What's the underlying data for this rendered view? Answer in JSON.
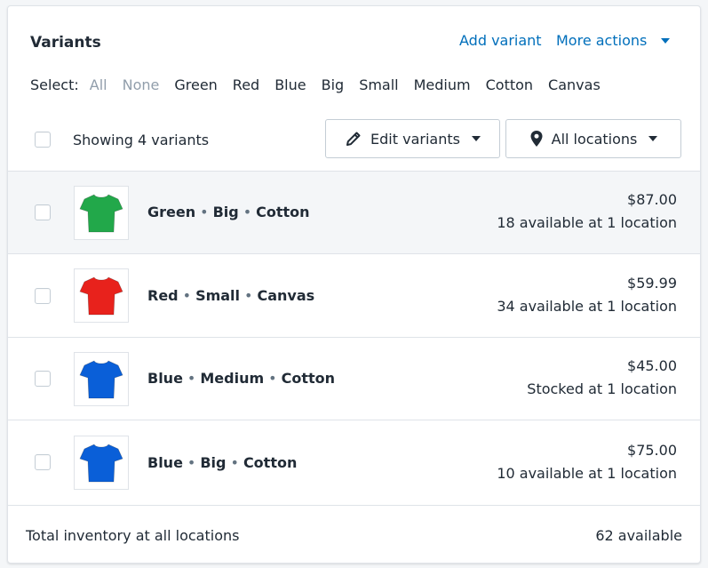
{
  "card": {
    "title": "Variants",
    "add_variant": "Add variant",
    "more_actions": "More actions"
  },
  "select": {
    "label": "Select:",
    "all": "All",
    "none": "None",
    "options": [
      "Green",
      "Red",
      "Blue",
      "Big",
      "Small",
      "Medium",
      "Cotton",
      "Canvas"
    ]
  },
  "toolbar": {
    "showing": "Showing 4 variants",
    "edit_variants": "Edit variants",
    "all_locations": "All locations"
  },
  "variants": [
    {
      "parts": [
        "Green",
        "Big",
        "Cotton"
      ],
      "price": "$87.00",
      "availability": "18 available at 1 location",
      "color": "#22a84a",
      "image_icon": "tshirt-icon"
    },
    {
      "parts": [
        "Red",
        "Small",
        "Canvas"
      ],
      "price": "$59.99",
      "availability": "34 available at 1 location",
      "color": "#e8221c",
      "image_icon": "tshirt-icon"
    },
    {
      "parts": [
        "Blue",
        "Medium",
        "Cotton"
      ],
      "price": "$45.00",
      "availability": "Stocked at 1 location",
      "color": "#0a5fd8",
      "image_icon": "tshirt-icon"
    },
    {
      "parts": [
        "Blue",
        "Big",
        "Cotton"
      ],
      "price": "$75.00",
      "availability": "10 available at 1 location",
      "color": "#0a5fd8",
      "image_icon": "tshirt-icon"
    }
  ],
  "footer": {
    "label": "Total inventory at all locations",
    "value": "62 available"
  },
  "colors": {
    "link": "#006fbb",
    "muted": "#919eab",
    "border": "#dfe3e8",
    "highlight_row": "#f4f6f8"
  }
}
